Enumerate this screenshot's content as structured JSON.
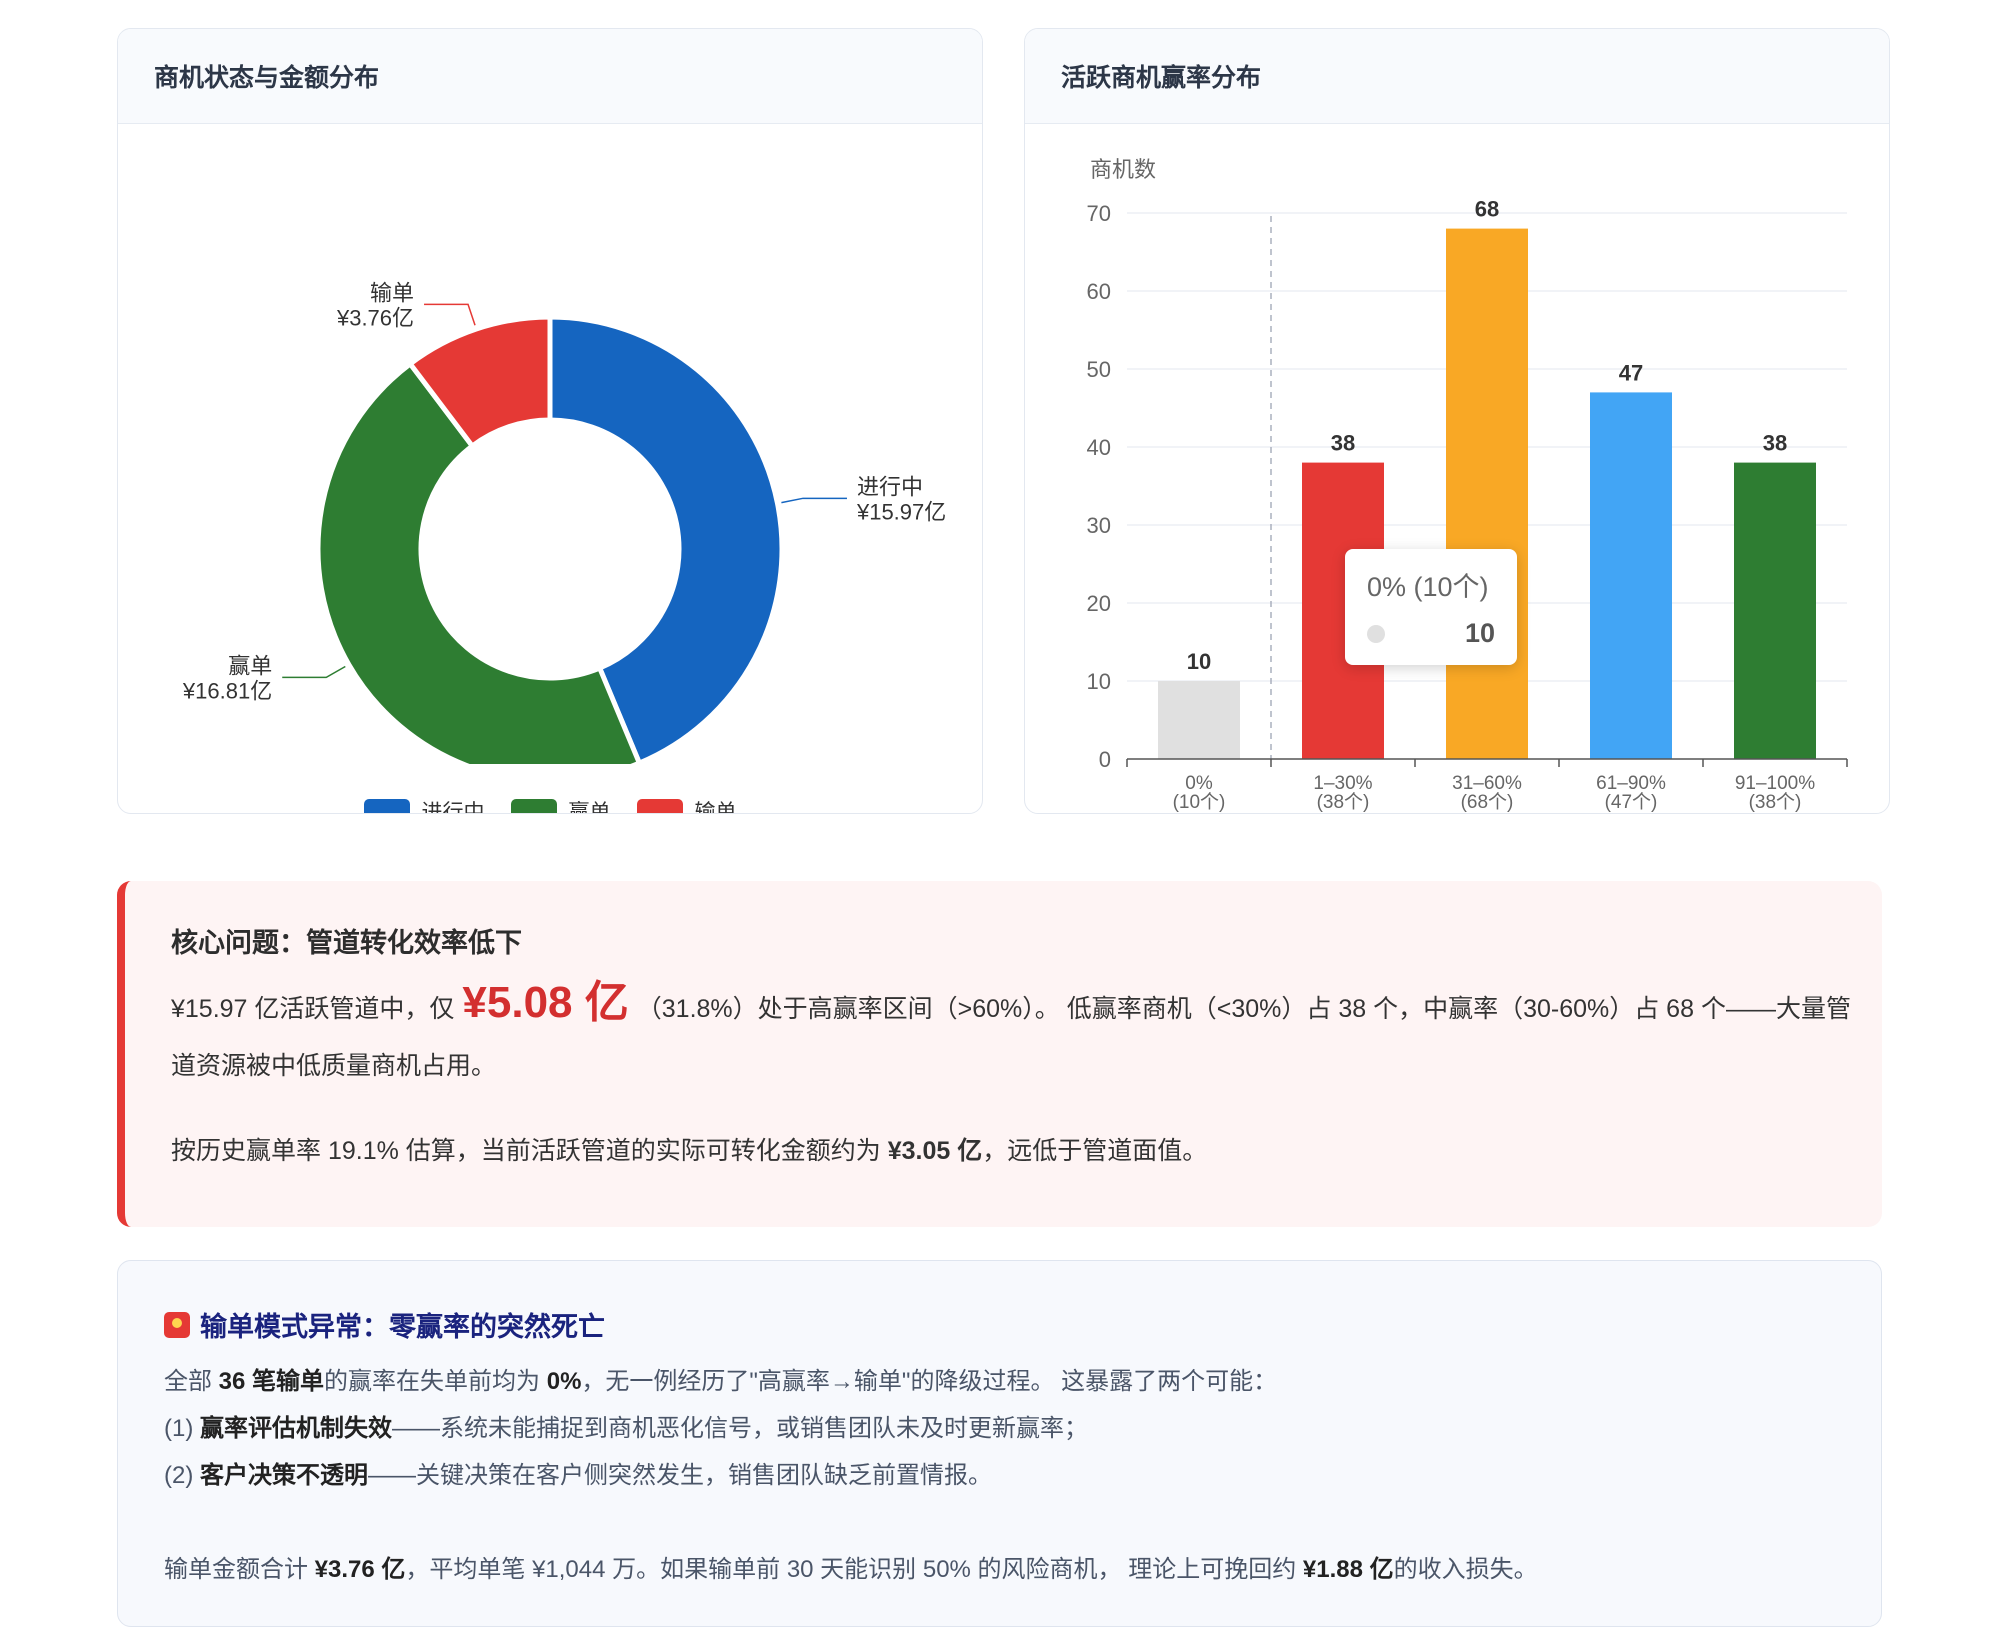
{
  "donut_card": {
    "title": "商机状态与金额分布",
    "legend": [
      {
        "label": "进行中",
        "color": "#1565c0"
      },
      {
        "label": "赢单",
        "color": "#2e7d32"
      },
      {
        "label": "输单",
        "color": "#e53935"
      }
    ]
  },
  "bar_card": {
    "title": "活跃商机赢率分布",
    "tooltip": {
      "title": "0% (10个)",
      "value": "10"
    }
  },
  "chart_data": [
    {
      "type": "pie",
      "title": "商机状态与金额分布",
      "donut": true,
      "categories": [
        "进行中",
        "赢单",
        "输单"
      ],
      "values": [
        15.97,
        16.81,
        3.76
      ],
      "value_labels": [
        "¥15.97亿",
        "¥16.81亿",
        "¥3.76亿"
      ],
      "colors": [
        "#1565c0",
        "#2e7d32",
        "#e53935"
      ],
      "legend": "bottom"
    },
    {
      "type": "bar",
      "title": "活跃商机赢率分布",
      "ylabel": "商机数",
      "categories": [
        "0%",
        "1–30%",
        "31–60%",
        "61–90%",
        "91–100%"
      ],
      "category_sublabels": [
        "(10个)",
        "(38个)",
        "(68个)",
        "(47个)",
        "(38个)"
      ],
      "values": [
        10,
        38,
        68,
        47,
        38
      ],
      "colors": [
        "#e0e0e0",
        "#e53935",
        "#f9a825",
        "#42a5f5",
        "#2e7d32"
      ],
      "ylim": [
        0,
        70
      ],
      "yticks": [
        0,
        10,
        20,
        30,
        40,
        50,
        60,
        70
      ],
      "grid": true
    }
  ],
  "alert": {
    "title": "核心问题：管道转化效率低下",
    "p1_a": "¥15.97 亿活跃管道中，仅",
    "p1_big": "¥5.08 亿",
    "p1_b": "（31.8%）处于高赢率区间（>60%）。 低赢率商机（<30%）占 38 个，中赢率（30-60%）占 68 个——大量管道资源被中低质量商机占用。",
    "p2_a": "按历史赢单率 19.1% 估算，当前活跃管道的实际可转化金额约为 ",
    "p2_b": "¥3.05 亿",
    "p2_c": "，远低于管道面值。"
  },
  "note": {
    "title": "输单模式异常：零赢率的突然死亡",
    "l1_a": "全部 ",
    "l1_b": "36 笔输单",
    "l1_c": "的赢率在失单前均为 ",
    "l1_d": "0%",
    "l1_e": "，无一例经历了\"高赢率→输单\"的降级过程。 这暴露了两个可能：",
    "l2_a": "(1) ",
    "l2_b": "赢率评估机制失效",
    "l2_c": "——系统未能捕捉到商机恶化信号，或销售团队未及时更新赢率；",
    "l3_a": "(2) ",
    "l3_b": "客户决策不透明",
    "l3_c": "——关键决策在客户侧突然发生，销售团队缺乏前置情报。",
    "l4_a": "输单金额合计 ",
    "l4_b": "¥3.76 亿",
    "l4_c": "，平均单笔 ¥1,044 万。如果输单前 30 天能识别 50% 的风险商机， 理论上可挽回约 ",
    "l4_d": "¥1.88 亿",
    "l4_e": "的收入损失。"
  }
}
